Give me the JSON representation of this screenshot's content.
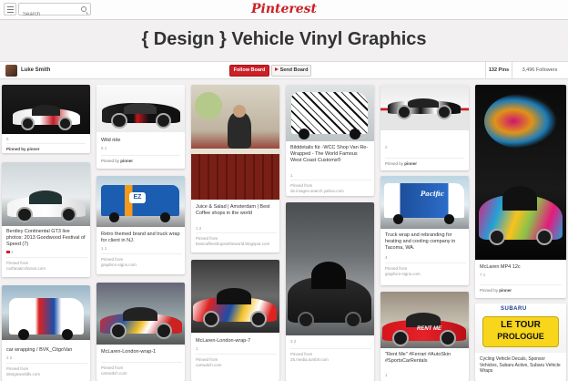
{
  "header": {
    "search_placeholder": "Search",
    "logo": "Pinterest"
  },
  "board": {
    "title": "{ Design } Vehicle Vinyl Graphics",
    "owner": "Luke Smith",
    "follow_label": "Follow Board",
    "send_label": "Send Board",
    "pins_count": "132 Pins",
    "followers_count": "3,496 Followers"
  },
  "pins": [
    {
      "stats": "5"
    },
    {
      "desc": "Wild ride",
      "stats": "5   1",
      "via_prefix": "Pinned by",
      "via_name": "pinner"
    },
    {
      "desc": "Juice & Salad | Amsterdam | Best Coffee shops in the world",
      "stats": "1   2",
      "src_label": "Pinned from",
      "src_url": "bestcoffeeshopsintheworld.blogspot.com"
    },
    {
      "desc": "Bilddetails für -WCC Shop Van Re-Wrapped - The World Famous West Coast Customs®",
      "stats": "1",
      "src_label": "Pinned from",
      "src_url": "de.images.search.yahoo.com"
    },
    {
      "stats": "2",
      "via_prefix": "Pinned by",
      "via_name": "pinner"
    },
    {
      "desc": "Pinned by pinner"
    },
    {
      "desc": "Bentley Continental GT3 live photos: 2013 Goodwood Festival of Speed (7)",
      "stats": "1",
      "src_label": "Pinned from",
      "src_url": "carfanaticsforum.com"
    },
    {
      "desc": "Retro themed brand and truck wrap for client in NJ.",
      "stats": "1   1",
      "src_label": "Pinned from",
      "src_url": "graphics-signs.com"
    },
    {
      "desc": "Truck wrap and rebranding for heating and cooling company in Tacoma, WA.",
      "stats": "4",
      "src_label": "Pinned from",
      "src_url": "graphics-signs.com"
    },
    {
      "desc": "McLaren MP4 12c",
      "stats": "7   1",
      "via_prefix": "Pinned by",
      "via_name": "pinner"
    },
    {
      "desc": "car wrapping / BVK_CitgoVan",
      "stats": "2   2",
      "src_label": "Pinned from",
      "src_url": "designworldls.com"
    },
    {
      "desc": "McLaren-London-wrap-1",
      "src_label": "Pinned from",
      "src_url": "carswitch.com"
    },
    {
      "desc": "McLaren-London-wrap-7",
      "stats": "1",
      "src_label": "Pinned from",
      "src_url": "carswitch.com"
    },
    {
      "stats": "3   2",
      "src_label": "Pinned from",
      "src_url": "25.media.tumblr.com"
    },
    {
      "desc": "\"Rent Me\" #Ferrari #AutoSkin #SportsCarRentals",
      "stats": "1"
    },
    {
      "desc": "Cycling Vehicle Decals, Sponsor Vehicles, Subaru Active, Subaru Vehicle Wraps"
    }
  ],
  "image_labels": {
    "oz_van": "EZ",
    "pacific_van": "Pacific",
    "tour_banner_1": "LE TOUR",
    "tour_banner_2": "PROLOGUE",
    "subaru": "SUBARU",
    "rent_me": "RENT ME"
  },
  "colors": {
    "brand_red": "#cb2027",
    "background": "#f2f0f0"
  }
}
